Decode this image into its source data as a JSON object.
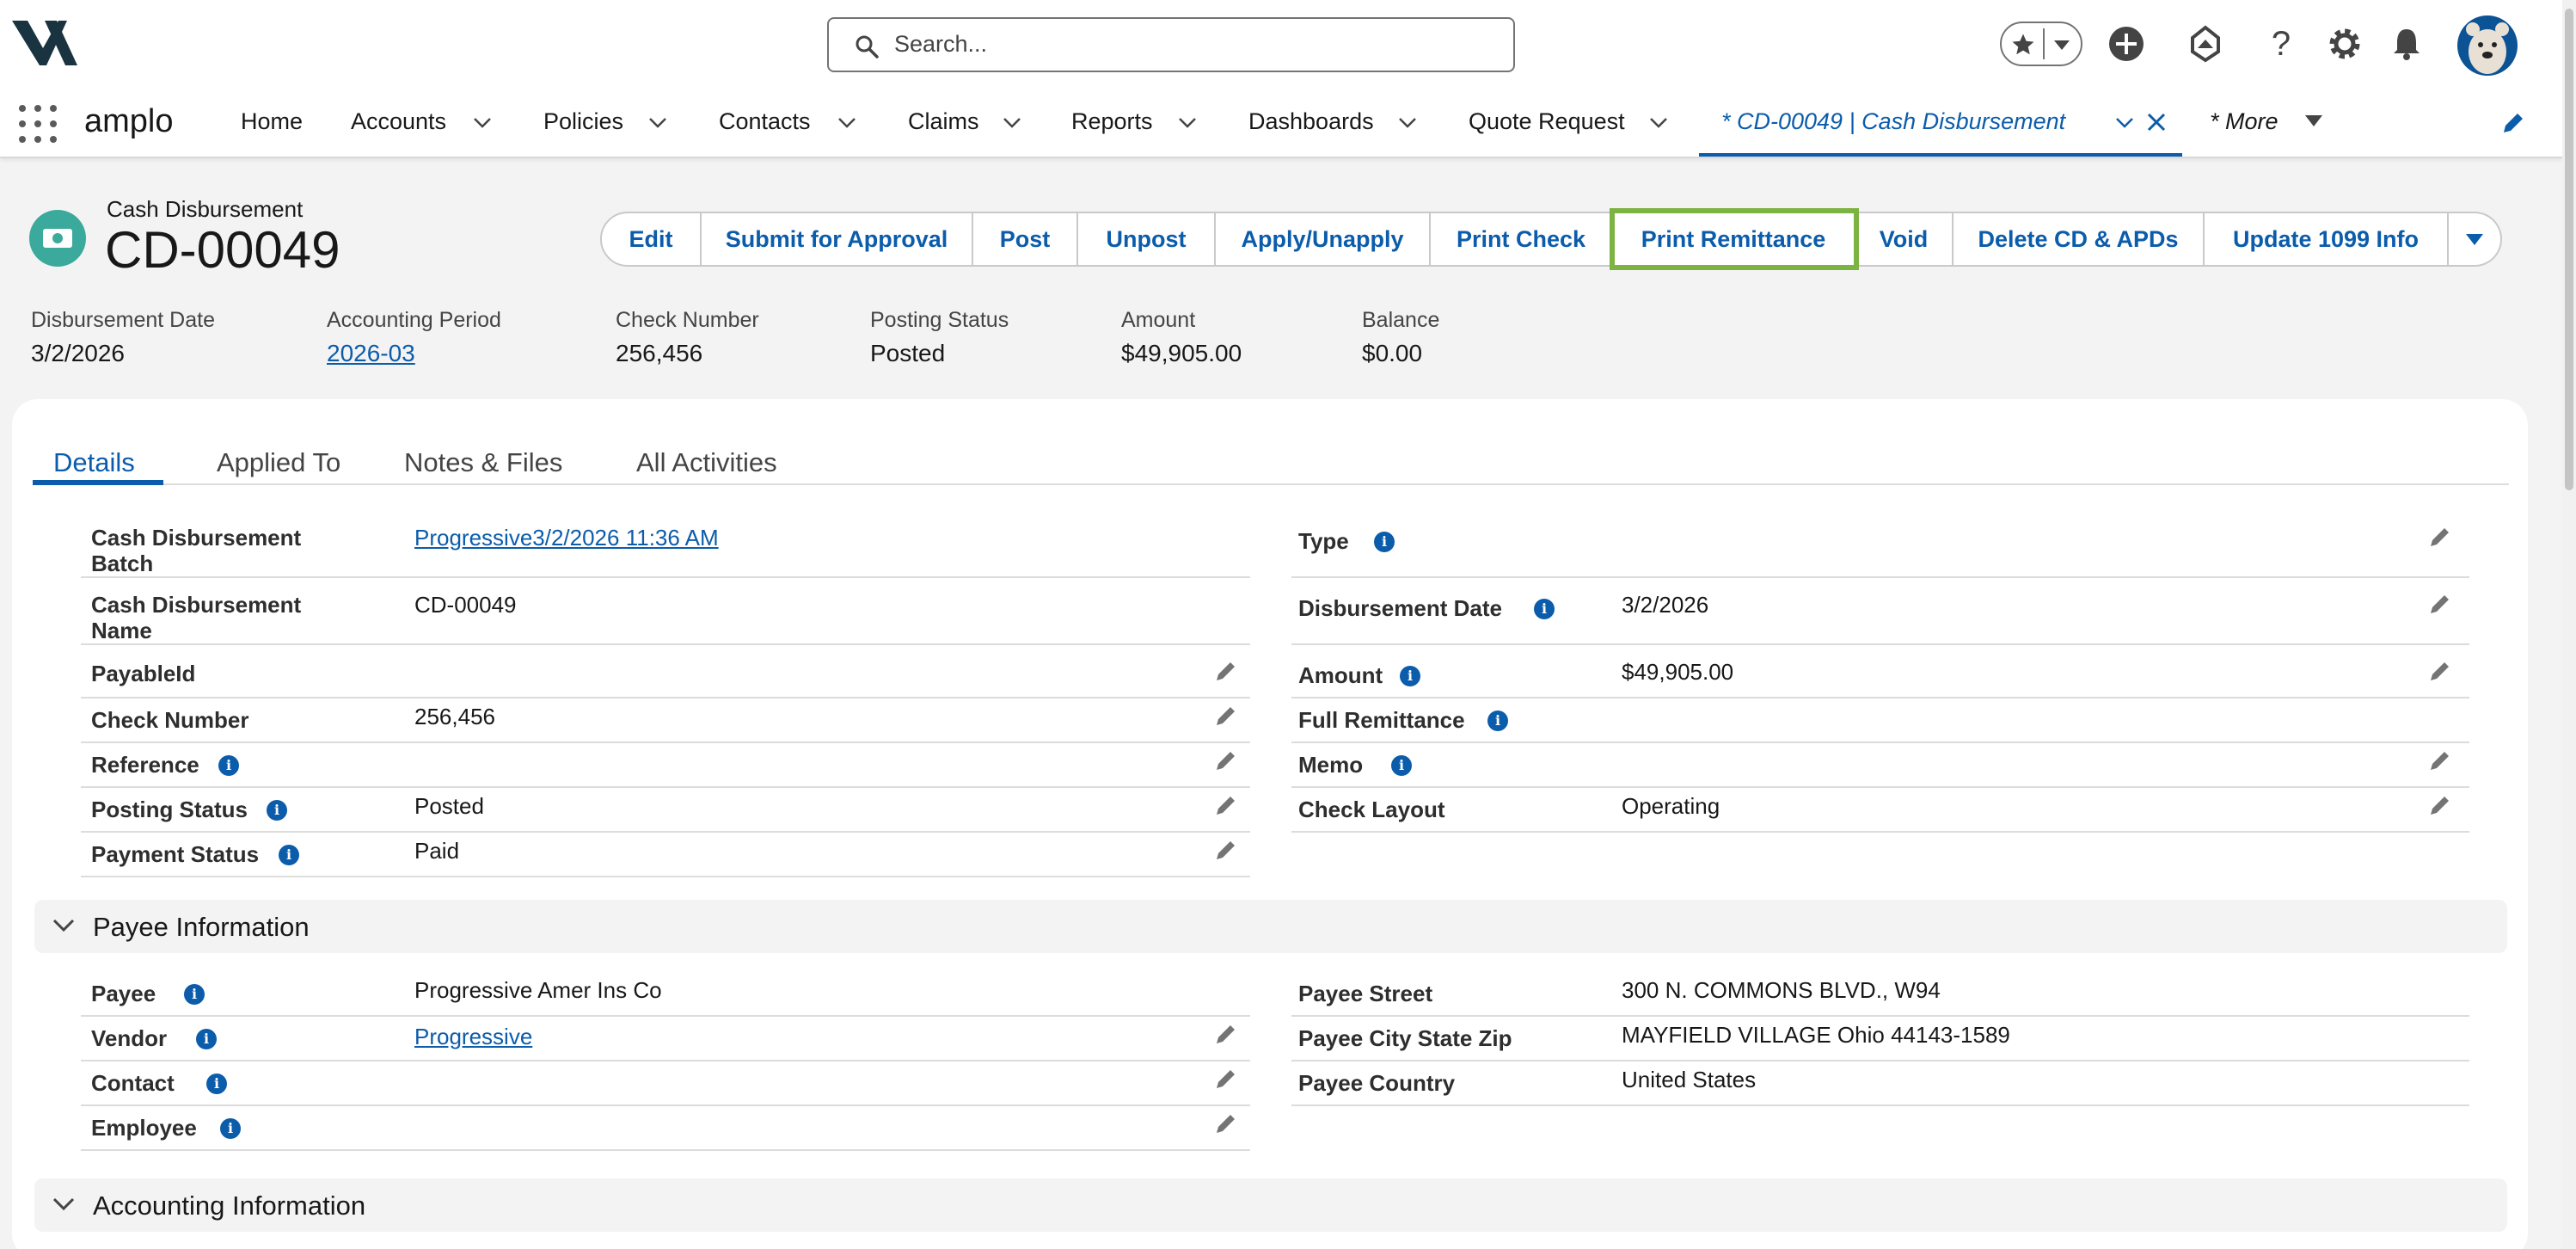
{
  "header": {
    "search_placeholder": "Search...",
    "icons": [
      "favorites-star-icon",
      "add-icon",
      "trailhead-icon",
      "help-icon",
      "setup-gear-icon",
      "notifications-bell-icon"
    ]
  },
  "nav": {
    "app_name": "amplo",
    "items": [
      {
        "label": "Home",
        "has_menu": false
      },
      {
        "label": "Accounts",
        "has_menu": true
      },
      {
        "label": "Policies",
        "has_menu": true
      },
      {
        "label": "Contacts",
        "has_menu": true
      },
      {
        "label": "Claims",
        "has_menu": true
      },
      {
        "label": "Reports",
        "has_menu": true
      },
      {
        "label": "Dashboards",
        "has_menu": true
      },
      {
        "label": "Quote Request",
        "has_menu": true
      }
    ],
    "active_tab": "* CD-00049 | Cash Disbursement",
    "more": "* More"
  },
  "record": {
    "object_label": "Cash Disbursement",
    "name": "CD-00049",
    "actions": [
      "Edit",
      "Submit for Approval",
      "Post",
      "Unpost",
      "Apply/Unapply",
      "Print Check",
      "Print Remittance",
      "Void",
      "Delete CD & APDs",
      "Update 1099 Info"
    ],
    "highlighted_action": "Print Remittance",
    "highlights": [
      {
        "label": "Disbursement Date",
        "value": "3/2/2026"
      },
      {
        "label": "Accounting Period",
        "value": "2026-03"
      },
      {
        "label": "Check Number",
        "value": "256,456"
      },
      {
        "label": "Posting Status",
        "value": "Posted"
      },
      {
        "label": "Amount",
        "value": "$49,905.00"
      },
      {
        "label": "Balance",
        "value": "$0.00"
      }
    ]
  },
  "tabs": [
    "Details",
    "Applied To",
    "Notes & Files",
    "All Activities"
  ],
  "details": {
    "left": [
      {
        "label": "Cash Disbursement Batch",
        "value": "Progressive3/2/2026 11:36 AM"
      },
      {
        "label": "Cash Disbursement Name",
        "value": "CD-00049"
      },
      {
        "label": "PayableId",
        "value": ""
      },
      {
        "label": "Check Number",
        "value": "256,456"
      },
      {
        "label": "Reference",
        "value": ""
      },
      {
        "label": "Posting Status",
        "value": "Posted"
      },
      {
        "label": "Payment Status",
        "value": "Paid"
      }
    ],
    "right": [
      {
        "label": "Type",
        "value": ""
      },
      {
        "label": "Disbursement Date",
        "value": "3/2/2026"
      },
      {
        "label": "Amount",
        "value": "$49,905.00"
      },
      {
        "label": "Full Remittance",
        "value": ""
      },
      {
        "label": "Memo",
        "value": ""
      },
      {
        "label": "Check Layout",
        "value": "Operating"
      }
    ]
  },
  "payee_section": {
    "title": "Payee Information",
    "left": [
      {
        "label": "Payee",
        "value": "Progressive Amer Ins Co"
      },
      {
        "label": "Vendor",
        "value": "Progressive"
      },
      {
        "label": "Contact",
        "value": ""
      },
      {
        "label": "Employee",
        "value": ""
      }
    ],
    "right": [
      {
        "label": "Payee Street",
        "value": "300 N. COMMONS BLVD., W94"
      },
      {
        "label": "Payee City State Zip",
        "value": "MAYFIELD VILLAGE Ohio 44143-1589"
      },
      {
        "label": "Payee Country",
        "value": "United States"
      }
    ]
  },
  "accounting_section": {
    "title": "Accounting Information"
  },
  "colors": {
    "brand_blue": "#0b5cab",
    "highlight_green": "#7cb342",
    "record_icon": "#3ba99c"
  }
}
